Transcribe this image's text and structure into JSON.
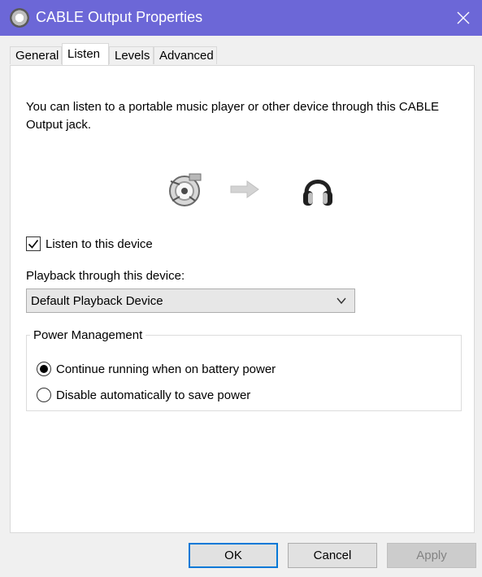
{
  "window": {
    "title": "CABLE Output Properties",
    "icon": "speaker-icon",
    "accent_color": "#6c67d7"
  },
  "tabs": [
    {
      "label": "General",
      "active": false
    },
    {
      "label": "Listen",
      "active": true
    },
    {
      "label": "Levels",
      "active": false
    },
    {
      "label": "Advanced",
      "active": false
    }
  ],
  "listen": {
    "description": "You can listen to a portable music player or other device through this CABLE Output jack.",
    "icons": [
      "audio-jack-icon",
      "arrow-right-icon",
      "headphones-icon"
    ],
    "listen_checkbox_label": "Listen to this device",
    "listen_checked": true,
    "playback_label": "Playback through this device:",
    "playback_selected": "Default Playback Device"
  },
  "power": {
    "legend": "Power Management",
    "options": [
      {
        "label": "Continue running when on battery power",
        "selected": true
      },
      {
        "label": "Disable automatically to save power",
        "selected": false
      }
    ]
  },
  "buttons": {
    "ok": "OK",
    "cancel": "Cancel",
    "apply": "Apply",
    "apply_enabled": false
  }
}
